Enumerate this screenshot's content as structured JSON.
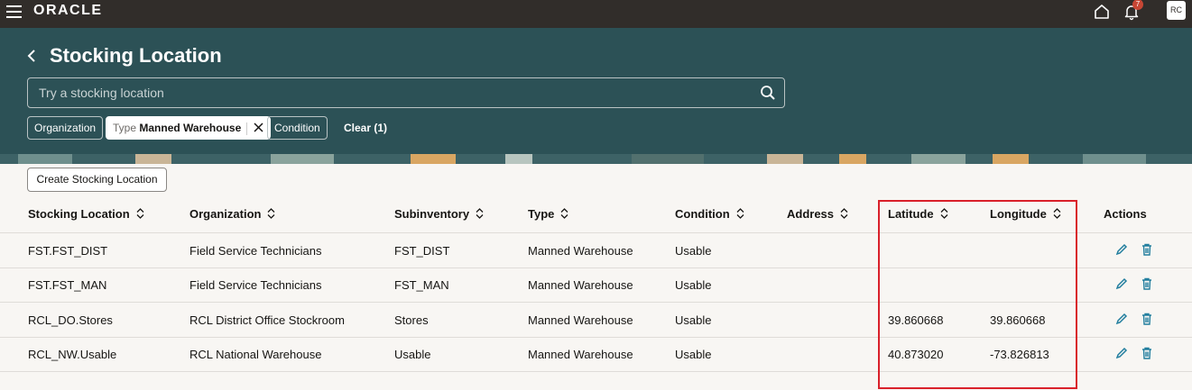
{
  "topbar": {
    "logo": "ORACLE",
    "notification_count": "7",
    "avatar_initials": "RC"
  },
  "header": {
    "title": "Stocking Location",
    "search_placeholder": "Try a stocking location",
    "filters": {
      "organization": "Organization",
      "type_label": "Type",
      "type_value": "Manned Warehouse",
      "condition": "Condition",
      "clear": "Clear (1)"
    }
  },
  "toolbar": {
    "create_label": "Create Stocking Location"
  },
  "table": {
    "headers": [
      "Stocking Location",
      "Organization",
      "Subinventory",
      "Type",
      "Condition",
      "Address",
      "Latitude",
      "Longitude",
      "Actions"
    ],
    "rows": [
      {
        "location": "FST.FST_DIST",
        "organization": "Field Service Technicians",
        "subinventory": "FST_DIST",
        "type": "Manned Warehouse",
        "condition": "Usable",
        "address": "",
        "latitude": "",
        "longitude": ""
      },
      {
        "location": "FST.FST_MAN",
        "organization": "Field Service Technicians",
        "subinventory": "FST_MAN",
        "type": "Manned Warehouse",
        "condition": "Usable",
        "address": "",
        "latitude": "",
        "longitude": ""
      },
      {
        "location": "RCL_DO.Stores",
        "organization": "RCL District Office Stockroom",
        "subinventory": "Stores",
        "type": "Manned Warehouse",
        "condition": "Usable",
        "address": "",
        "latitude": "39.860668",
        "longitude": "39.860668"
      },
      {
        "location": "RCL_NW.Usable",
        "organization": "RCL National Warehouse",
        "subinventory": "Usable",
        "type": "Manned Warehouse",
        "condition": "Usable",
        "address": "",
        "latitude": "40.873020",
        "longitude": "-73.826813"
      }
    ]
  },
  "colors": {
    "topbar": "#312d2a",
    "header": "#2c5156",
    "accent": "#227e9e",
    "highlight": "#d9202a"
  }
}
